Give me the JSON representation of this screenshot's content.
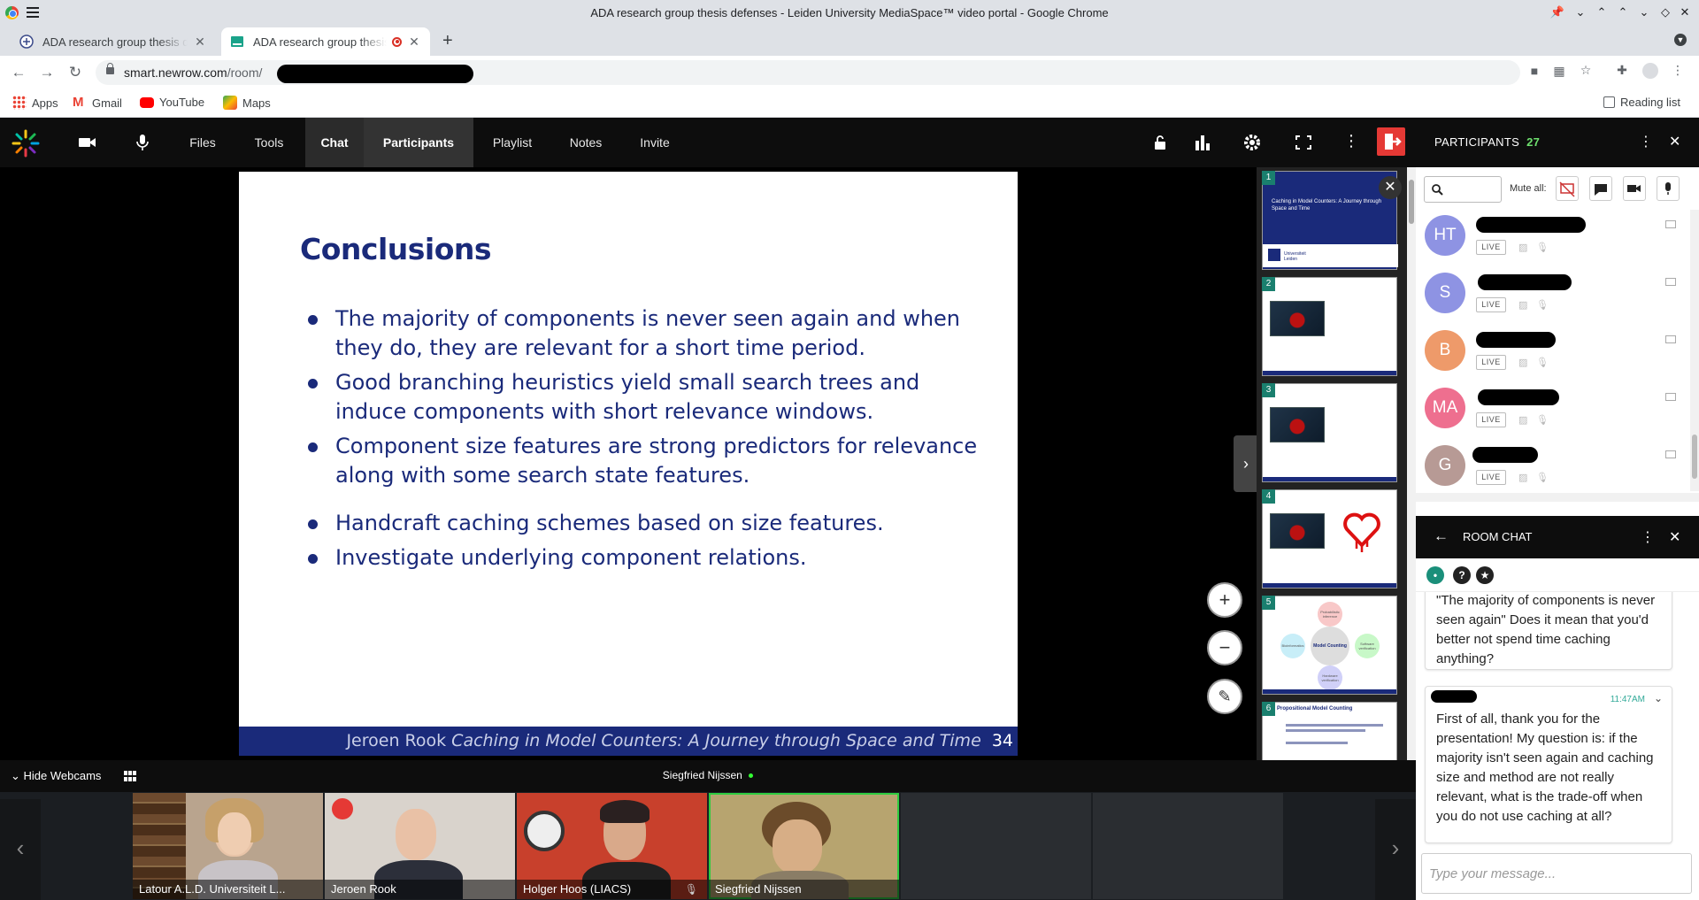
{
  "window": {
    "title": "ADA research group thesis defenses - Leiden University MediaSpace™ video portal - Google Chrome"
  },
  "tabs": [
    {
      "label": "ADA research group thesis defenses"
    },
    {
      "label": "ADA research group thesis defenses"
    }
  ],
  "address": {
    "url_host": "smart.newrow.com",
    "url_path": "/room/"
  },
  "bookmarks": {
    "apps": "Apps",
    "gmail": "Gmail",
    "youtube": "YouTube",
    "maps": "Maps",
    "reading_list": "Reading list"
  },
  "appnav": {
    "files": "Files",
    "tools": "Tools",
    "chat": "Chat",
    "participants": "Participants",
    "playlist": "Playlist",
    "notes": "Notes",
    "invite": "Invite"
  },
  "slide": {
    "title": "Conclusions",
    "bullets": [
      "The majority of components is never seen again and when they do, they are relevant for a short time period.",
      "Good branching heuristics yield small search trees and induce components with short relevance windows.",
      "Component size features are strong predictors for relevance along with some search state features.",
      "Handcraft caching schemes based on size features.",
      "Investigate underlying component relations."
    ],
    "footer_author": "Jeroen Rook",
    "footer_talk": "Caching in Model Counters: A Journey through Space and Time",
    "page_number": "34"
  },
  "thumbnails": {
    "numbers": [
      "1",
      "2",
      "3",
      "4",
      "5",
      "6"
    ],
    "t1_title": "Caching in Model Counters: A Journey through Space and Time",
    "t1_logo": "Universiteit Leiden",
    "t5_center": "Model Counting",
    "t5_nodes": [
      "Probabilistic inference",
      "Bioinformatics",
      "Software verification",
      "Hardware verification"
    ],
    "t6_title": "Propositional Model Counting"
  },
  "webcams": {
    "hide_label": "Hide Webcams",
    "active_speaker": "Siegfried Nijssen",
    "cams": [
      {
        "name": "Latour A.L.D. Universiteit L..."
      },
      {
        "name": "Jeroen Rook"
      },
      {
        "name": "Holger Hoos (LIACS)"
      },
      {
        "name": "Siegfried Nijssen"
      }
    ]
  },
  "participants": {
    "header": "PARTICIPANTS",
    "count": "27",
    "mute_all": "Mute all:",
    "live_label": "LIVE",
    "list": [
      {
        "initials": "HT",
        "color": "#8e93e3"
      },
      {
        "initials": "S",
        "color": "#8e93e3"
      },
      {
        "initials": "B",
        "color": "#ee9a6a"
      },
      {
        "initials": "MA",
        "color": "#ee6f8f"
      },
      {
        "initials": "G",
        "color": "#b79a95"
      }
    ]
  },
  "chat": {
    "header": "ROOM CHAT",
    "messages": [
      {
        "text": "\"The majority of components is never seen again\" Does it mean that you'd better not spend time caching anything?"
      },
      {
        "time": "11:47AM",
        "text": "First of all, thank you for the presentation! My question is: if the majority isn't seen again and caching size and method are not really relevant, what is the trade-off when you do not use caching at all?"
      }
    ],
    "placeholder": "Type your message..."
  }
}
